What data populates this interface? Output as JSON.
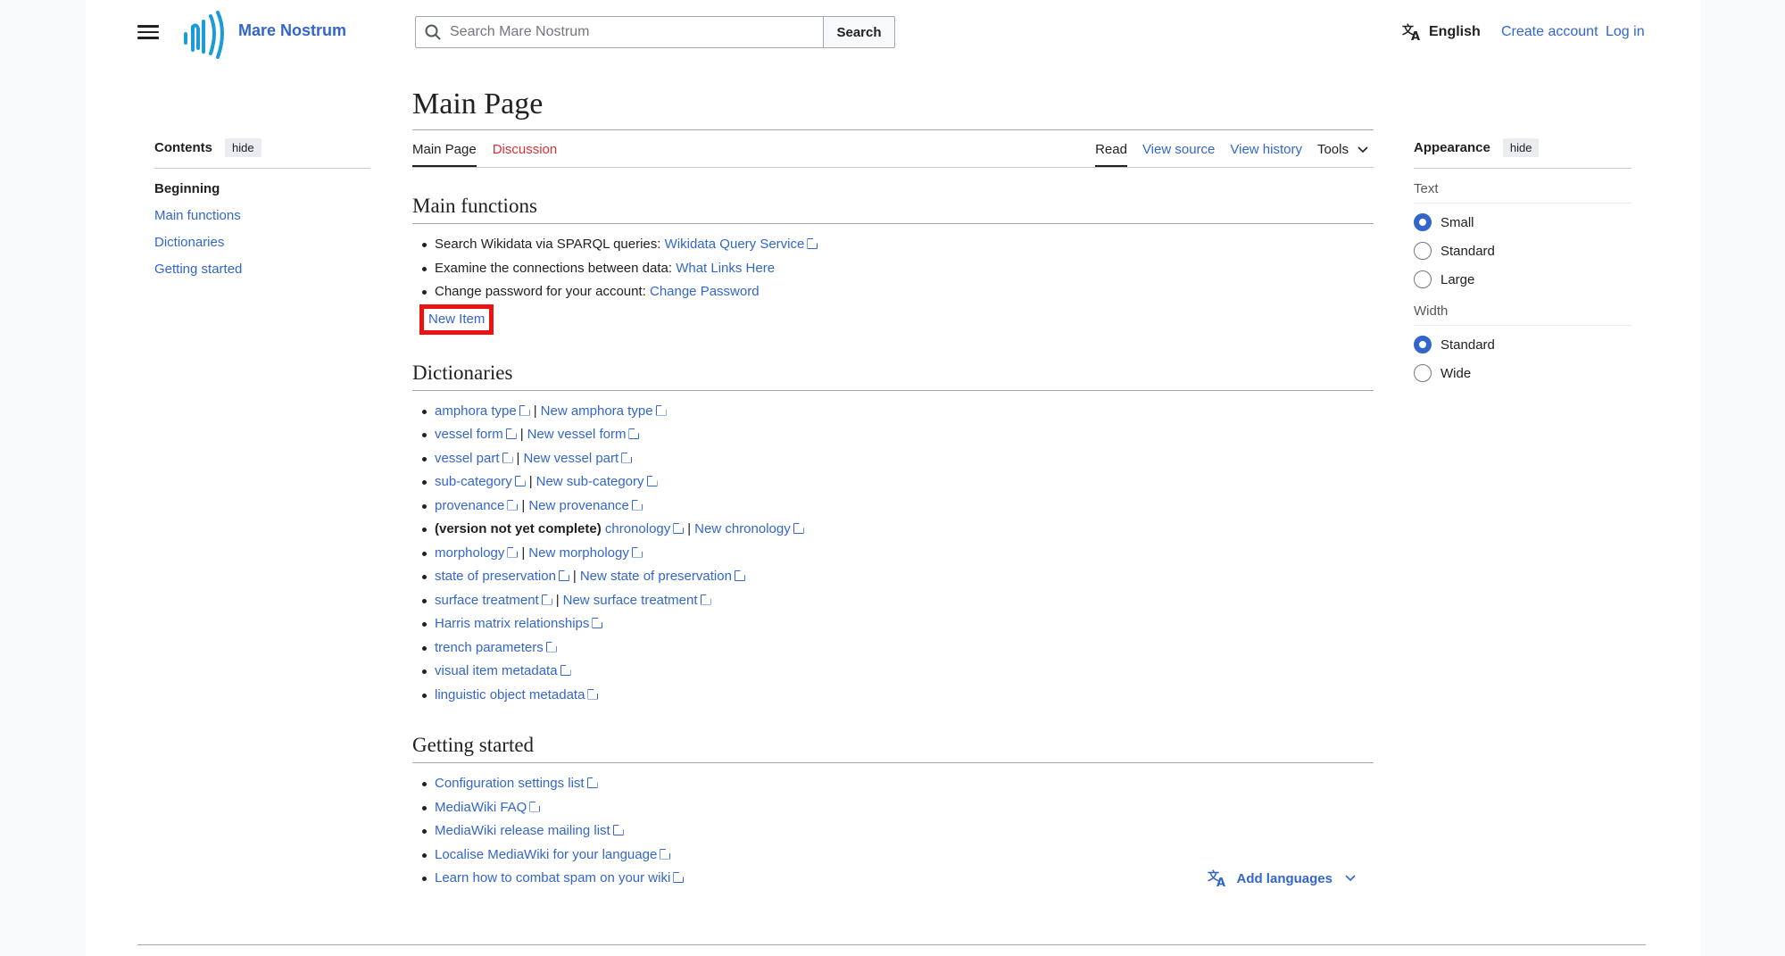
{
  "header": {
    "site_name": "Mare Nostrum",
    "search_placeholder": "Search Mare Nostrum",
    "search_button": "Search",
    "language": "English",
    "create_account": "Create account",
    "login": "Log in"
  },
  "toc": {
    "title": "Contents",
    "hide_label": "hide",
    "items": [
      "Beginning",
      "Main functions",
      "Dictionaries",
      "Getting started"
    ]
  },
  "page": {
    "title": "Main Page",
    "tabs_left": [
      "Main Page",
      "Discussion"
    ],
    "tabs_right": [
      "Read",
      "View source",
      "View history",
      "Tools"
    ]
  },
  "main_functions": {
    "heading": "Main functions",
    "items": [
      {
        "text": "Search Wikidata via SPARQL queries:",
        "link": "Wikidata Query Service"
      },
      {
        "text": "Examine the connections between data:",
        "link": "What Links Here"
      },
      {
        "text": "Change password for your account:",
        "link": "Change Password"
      }
    ],
    "new_item": "New Item"
  },
  "dictionaries": {
    "heading": "Dictionaries",
    "items": [
      {
        "a": "amphora type",
        "b": "New amphora type"
      },
      {
        "a": "vessel form",
        "b": "New vessel form"
      },
      {
        "a": "vessel part",
        "b": "New vessel part"
      },
      {
        "a": "sub-category",
        "b": "New sub-category"
      },
      {
        "a": "provenance",
        "b": "New provenance"
      },
      {
        "prefix": "(version not yet complete)",
        "a": "chronology",
        "b": "New chronology"
      },
      {
        "a": "morphology",
        "b": "New morphology"
      },
      {
        "a": "state of preservation",
        "b": "New state of preservation"
      },
      {
        "a": "surface treatment",
        "b": "New surface treatment"
      },
      {
        "a": "Harris matrix relationships"
      },
      {
        "a": "trench parameters"
      },
      {
        "a": "visual item metadata"
      },
      {
        "a": "linguistic object metadata"
      }
    ]
  },
  "getting_started": {
    "heading": "Getting started",
    "items": [
      "Configuration settings list",
      "MediaWiki FAQ",
      "MediaWiki release mailing list",
      "Localise MediaWiki for your language",
      "Learn how to combat spam on your wiki"
    ]
  },
  "add_languages": "Add languages",
  "appearance": {
    "title": "Appearance",
    "hide_label": "hide",
    "text_label": "Text",
    "text_options": [
      "Small",
      "Standard",
      "Large"
    ],
    "text_selected": "Small",
    "width_label": "Width",
    "width_options": [
      "Standard",
      "Wide"
    ],
    "width_selected": "Standard"
  },
  "colors": {
    "link": "#3366cc",
    "red_link": "#d73333",
    "highlight": "#ee1111",
    "logo": "#1a9cd8"
  }
}
